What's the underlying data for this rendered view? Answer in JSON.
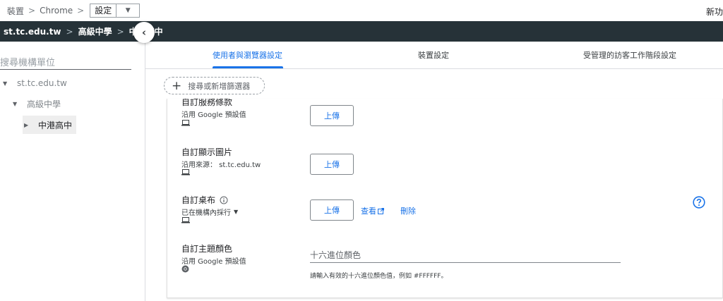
{
  "breadcrumb": {
    "items": [
      "裝置",
      "Chrome"
    ],
    "separator": ">",
    "current": "設定",
    "new_label": "新功"
  },
  "org_path": {
    "items": [
      "st.tc.edu.tw",
      "高級中學",
      "中港高中"
    ],
    "separator": ">"
  },
  "left_panel": {
    "search_placeholder": "搜尋機構單位",
    "tree": [
      {
        "label": "st.tc.edu.tw",
        "expanded": true
      },
      {
        "label": "高級中學",
        "expanded": true
      },
      {
        "label": "中港高中",
        "expanded": false,
        "selected": true
      }
    ]
  },
  "tabs": [
    {
      "label": "使用者與瀏覽器設定",
      "active": true
    },
    {
      "label": "裝置設定",
      "active": false
    },
    {
      "label": "受管理的訪客工作階段設定",
      "active": false
    }
  ],
  "filter": {
    "label": "搜尋或新增篩選器"
  },
  "settings": [
    {
      "title": "自訂服務條款",
      "subtitle": "沿用 Google 預設值",
      "icon": "laptop-icon",
      "button": "上傳"
    },
    {
      "title": "自訂顯示圖片",
      "subtitle": "沿用來源： st.tc.edu.tw",
      "icon": "laptop-icon",
      "button": "上傳"
    },
    {
      "title": "自訂桌布",
      "subtitle": "已在機構內採行",
      "icon": "laptop-icon",
      "button": "上傳",
      "view_label": "查看",
      "delete_label": "刪除"
    },
    {
      "title": "自訂主題顏色",
      "subtitle": "沿用 Google 預設值",
      "icon": "chrome-icon",
      "input_placeholder": "十六進位顏色",
      "hint": "請輸入有效的十六進位顏色值，例如 #FFFFFF。"
    }
  ],
  "colors": {
    "accent": "#1a73e8",
    "dark_bar": "#263238"
  }
}
